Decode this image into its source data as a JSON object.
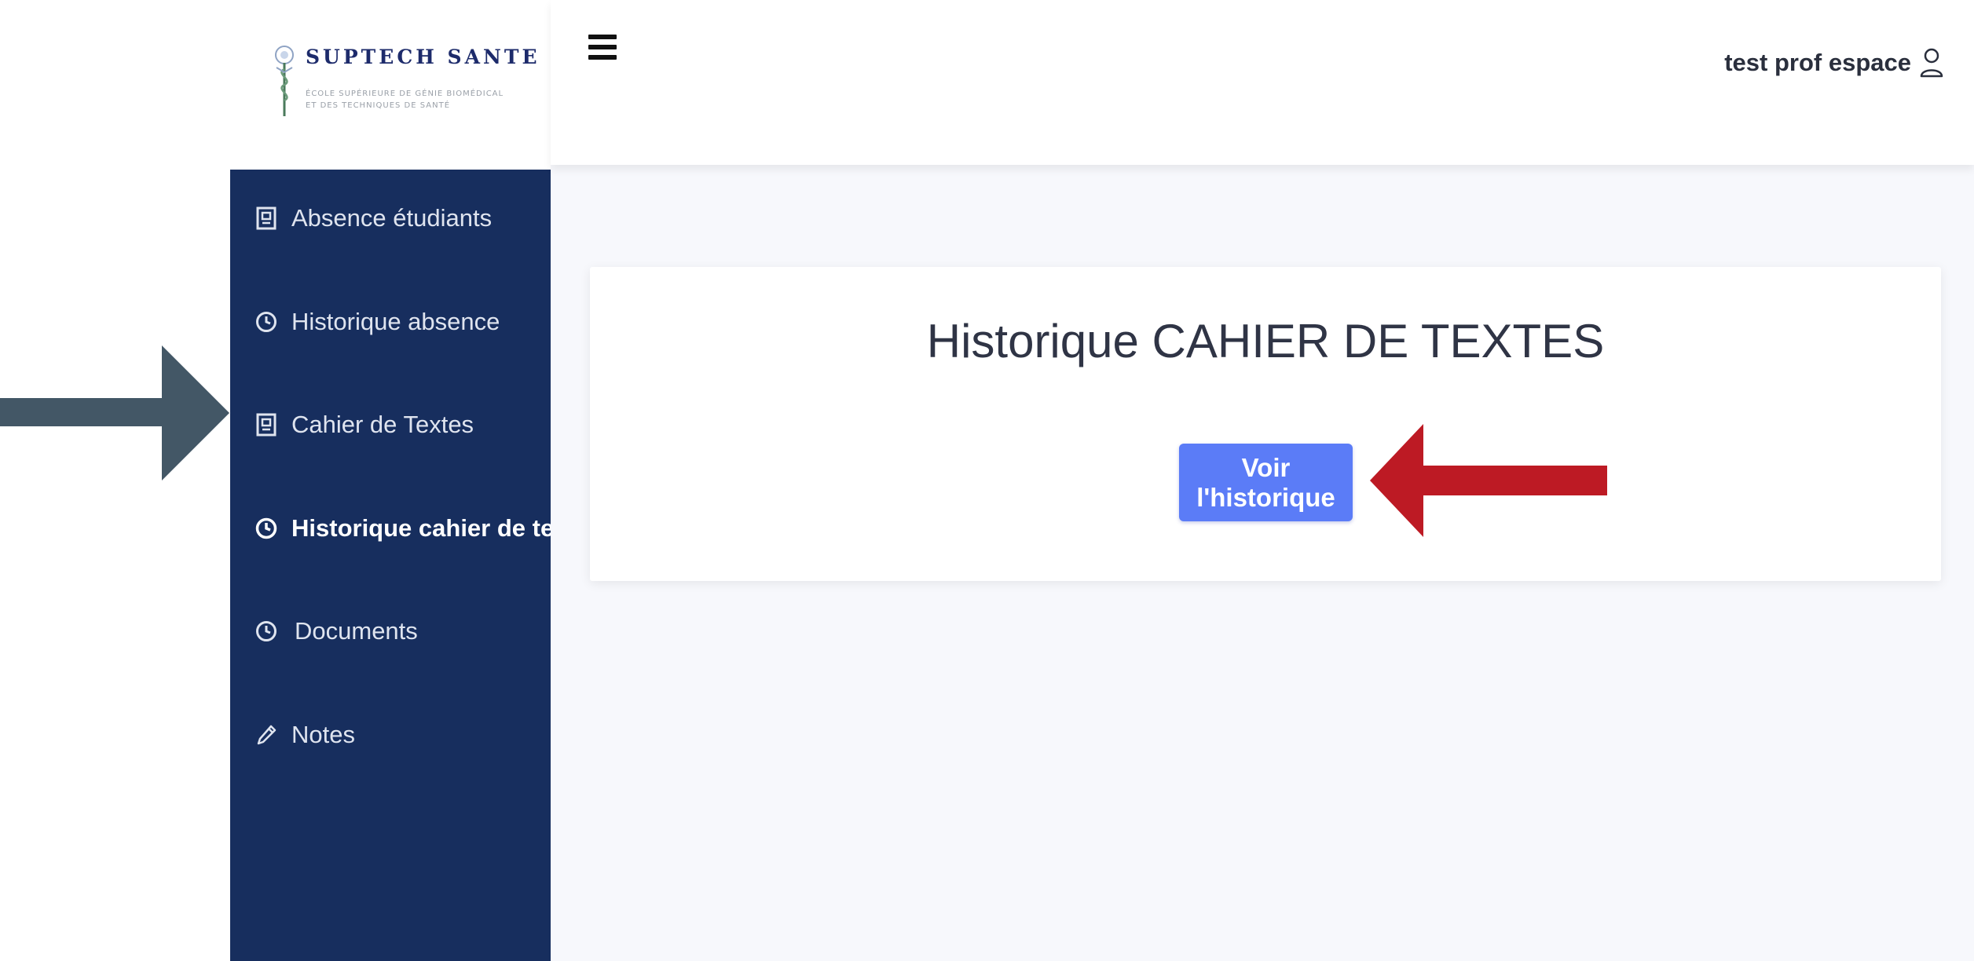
{
  "brand": {
    "name": "SUPTECH SANTE",
    "tagline_line1": "ÉCOLE SUPÉRIEURE DE GÉNIE BIOMÉDICAL",
    "tagline_line2": "ET DES TECHNIQUES DE SANTÉ",
    "logo_icon": "caduceus-logo-icon"
  },
  "sidebar": {
    "items": [
      {
        "label": "Absence étudiants",
        "icon": "document-icon",
        "active": false
      },
      {
        "label": "Historique absence",
        "icon": "clock-icon",
        "active": false
      },
      {
        "label": "Cahier de Textes",
        "icon": "document-icon",
        "active": false
      },
      {
        "label": "Historique cahier de textes",
        "icon": "clock-icon",
        "active": true
      },
      {
        "label": "Documents",
        "icon": "clock-icon",
        "active": false
      },
      {
        "label": "Notes",
        "icon": "pen-icon",
        "active": false
      }
    ]
  },
  "topbar": {
    "menu_icon": "hamburger-menu-icon",
    "user_name": "test prof espace",
    "user_icon": "user-icon"
  },
  "main": {
    "card_title": "Historique CAHIER DE TEXTES",
    "button_label": "Voir l'historique"
  },
  "annotations": {
    "left_arrow_color": "#435766",
    "right_arrow_color": "#bd1a24"
  },
  "colors": {
    "sidebar_bg": "#172e5e",
    "accent_button": "#5b7cf7",
    "content_bg": "#f7f8fc"
  }
}
